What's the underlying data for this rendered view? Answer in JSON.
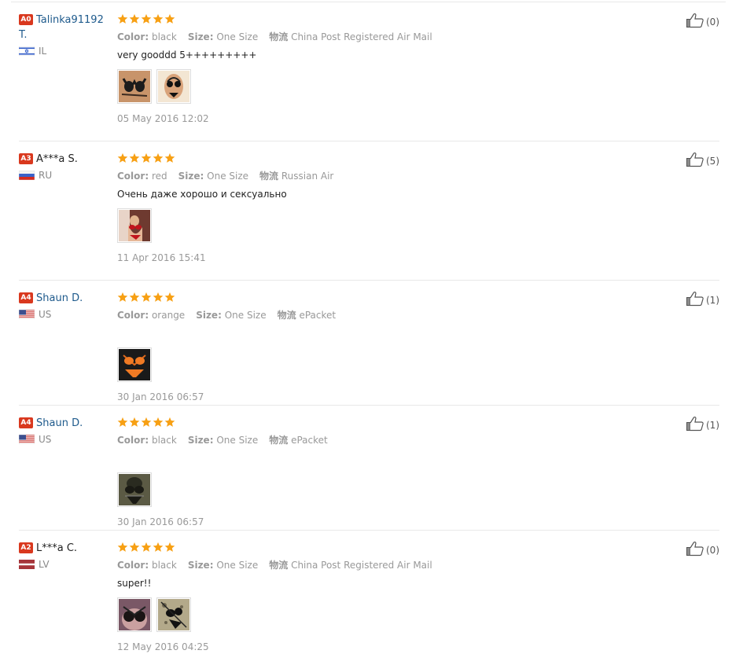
{
  "colors": {
    "link": "#1e5a8c",
    "star": "#f7a014",
    "badge": "#d9381e"
  },
  "labels": {
    "color": "Color:",
    "size": "Size:",
    "logistics": "物流"
  },
  "reviews": [
    {
      "badge": "A0",
      "name": "Talinka91192 T.",
      "name_is_link": true,
      "country": "IL",
      "flag": "il",
      "stars": 5,
      "color": "black",
      "size": "One Size",
      "shipping": "China Post Registered Air Mail",
      "text": "very gooddd 5+++++++++",
      "photos": [
        "bikini-black-top",
        "bikini-black-bottom"
      ],
      "date": "05 May 2016 12:02",
      "helpful": "(0)"
    },
    {
      "badge": "A3",
      "name": "A***a S.",
      "name_is_link": false,
      "country": "RU",
      "flag": "ru",
      "stars": 5,
      "color": "red",
      "size": "One Size",
      "shipping": "Russian Air",
      "text": "Очень даже хорошо и сексуально",
      "photos": [
        "bikini-red"
      ],
      "date": "11 Apr 2016 15:41",
      "helpful": "(5)"
    },
    {
      "badge": "A4",
      "name": "Shaun D.",
      "name_is_link": true,
      "country": "US",
      "flag": "us",
      "stars": 5,
      "color": "orange",
      "size": "One Size",
      "shipping": "ePacket",
      "text": "",
      "photos": [
        "bikini-orange"
      ],
      "date": "30 Jan 2016 06:57",
      "helpful": "(1)"
    },
    {
      "badge": "A4",
      "name": "Shaun D.",
      "name_is_link": true,
      "country": "US",
      "flag": "us",
      "stars": 5,
      "color": "black",
      "size": "One Size",
      "shipping": "ePacket",
      "text": "",
      "photos": [
        "bikini-black"
      ],
      "date": "30 Jan 2016 06:57",
      "helpful": "(1)"
    },
    {
      "badge": "A2",
      "name": "L***a C.",
      "name_is_link": false,
      "country": "LV",
      "flag": "lv",
      "stars": 5,
      "color": "black",
      "size": "One Size",
      "shipping": "China Post Registered Air Mail",
      "text": "super!!",
      "photos": [
        "bikini-black-worn",
        "bikini-black-flat"
      ],
      "date": "12 May 2016 04:25",
      "helpful": "(0)"
    }
  ]
}
